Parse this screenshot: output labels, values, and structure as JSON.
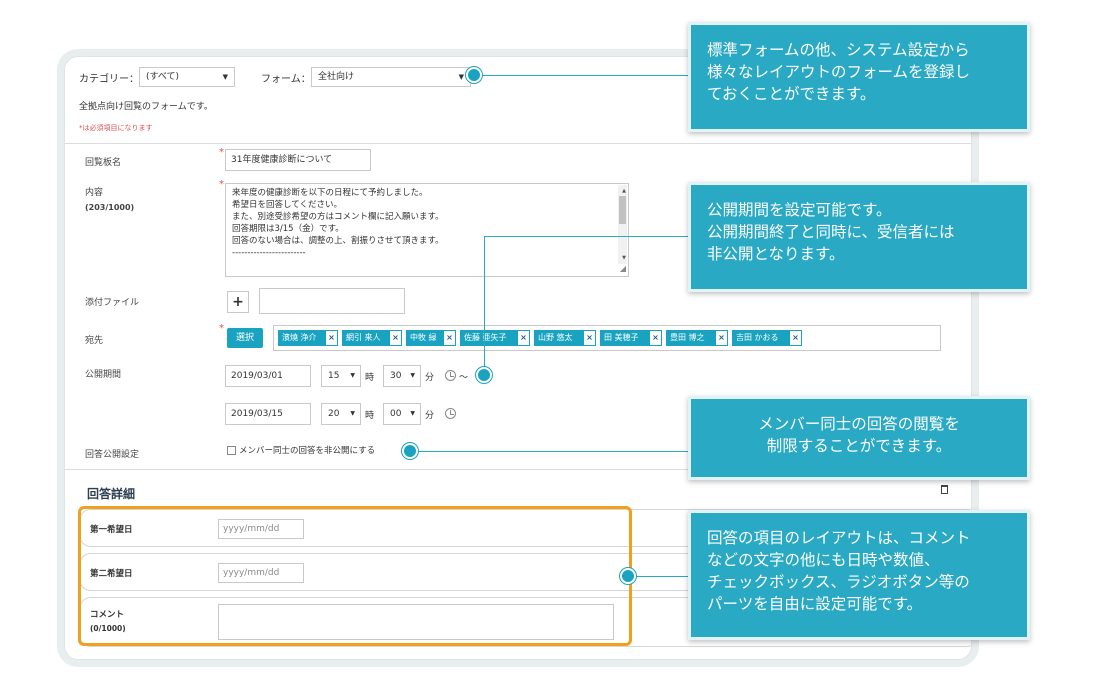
{
  "filters": {
    "category_label": "カテゴリー：",
    "category_value": "(すべて)",
    "form_label": "フォーム：",
    "form_value": "全社向け"
  },
  "form_description": "全拠点向け回覧のフォームです。",
  "required_note": "*は必須項目になります",
  "fields": {
    "title_label": "回覧板名",
    "title_value": "31年度健康診断について",
    "content_label": "内容",
    "content_count": "(203/1000)",
    "content_lines": [
      "来年度の健康診断を以下の日程にて予約しました。",
      "希望日を回答してください。",
      "また、別途受診希望の方はコメント欄に記入願います。",
      "回答期限は3/15（金）です。",
      "回答のない場合は、調整の上、割振りさせて頂きます。",
      "------------------------"
    ],
    "attach_label": "添付ファイル",
    "attach_button": "+",
    "recipients_label": "宛先",
    "select_button": "選択",
    "recipients": [
      "濱燒 浄介",
      "網引 来人",
      "中牧 緑",
      "佐藤 亜矢子",
      "山野 悠太",
      "田 美穂子",
      "豊田 博之",
      "吉田 かおる"
    ],
    "remove_symbol": "×",
    "period_label": "公開期間",
    "start_date": "2019/03/01",
    "start_hour": "15",
    "start_minute": "30",
    "end_date": "2019/03/15",
    "end_hour": "20",
    "end_minute": "00",
    "hour_unit": "時",
    "minute_unit": "分",
    "range_symbol": "〜",
    "answer_visibility_label": "回答公開設定",
    "answer_visibility_checkbox": "メンバー同士の回答を非公開にする"
  },
  "answer_details": {
    "title": "回答詳細",
    "rows": [
      {
        "label": "第一希望日",
        "placeholder": "yyyy/mm/dd"
      },
      {
        "label": "第二希望日",
        "placeholder": "yyyy/mm/dd"
      },
      {
        "label": "コメント",
        "count": "(0/1000)"
      }
    ]
  },
  "callouts": {
    "form_layouts": [
      "標準フォームの他、システム設定から",
      "様々なレイアウトのフォームを登録し",
      "ておくことができます。"
    ],
    "publish_period": [
      "公開期間を設定可能です。",
      "公開期間終了と同時に、受信者には",
      "非公開となります。"
    ],
    "answer_visibility": [
      "メンバー同士の回答の閲覧を",
      "制限することができます。"
    ],
    "answer_layout": [
      "回答の項目のレイアウトは、コメント",
      "などの文字の他にも日時や数値、",
      "チェックボックス、ラジオボタン等の",
      "パーツを自由に設定可能です。"
    ]
  },
  "colors": {
    "accent": "#29a9c4",
    "highlight": "#f0a01e",
    "required": "#d9534f"
  }
}
